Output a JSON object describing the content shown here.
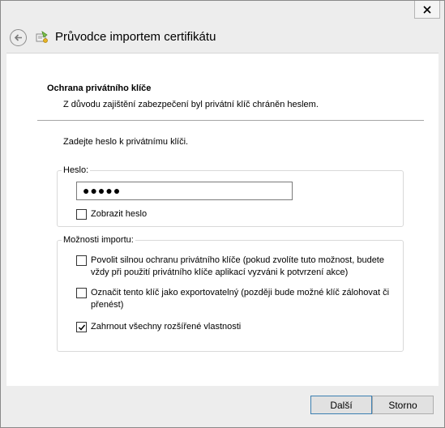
{
  "window": {
    "title": "Průvodce importem certifikátu"
  },
  "section": {
    "title": "Ochrana privátního klíče",
    "subtitle": "Z důvodu zajištění zabezpečení byl privátní klíč chráněn heslem."
  },
  "prompt": "Zadejte heslo k privátnímu klíči.",
  "password_group": {
    "legend": "Heslo:",
    "value": "●●●●●",
    "show_password": {
      "label": "Zobrazit heslo",
      "checked": false
    }
  },
  "import_options": {
    "legend": "Možnosti importu:",
    "options": [
      {
        "label": "Povolit silnou ochranu privátního klíče (pokud zvolíte tuto možnost, budete vždy při použití privátního klíče aplikací vyzváni k potvrzení akce)",
        "checked": false
      },
      {
        "label": "Označit tento klíč jako exportovatelný (později bude možné klíč zálohovat či přenést)",
        "checked": false
      },
      {
        "label": "Zahrnout všechny rozšířené vlastnosti",
        "checked": true
      }
    ]
  },
  "buttons": {
    "next": "Další",
    "cancel": "Storno"
  },
  "icons": {
    "close": "close-icon",
    "back": "back-arrow-icon",
    "app": "certificate-icon",
    "check": "checkmark-icon"
  }
}
